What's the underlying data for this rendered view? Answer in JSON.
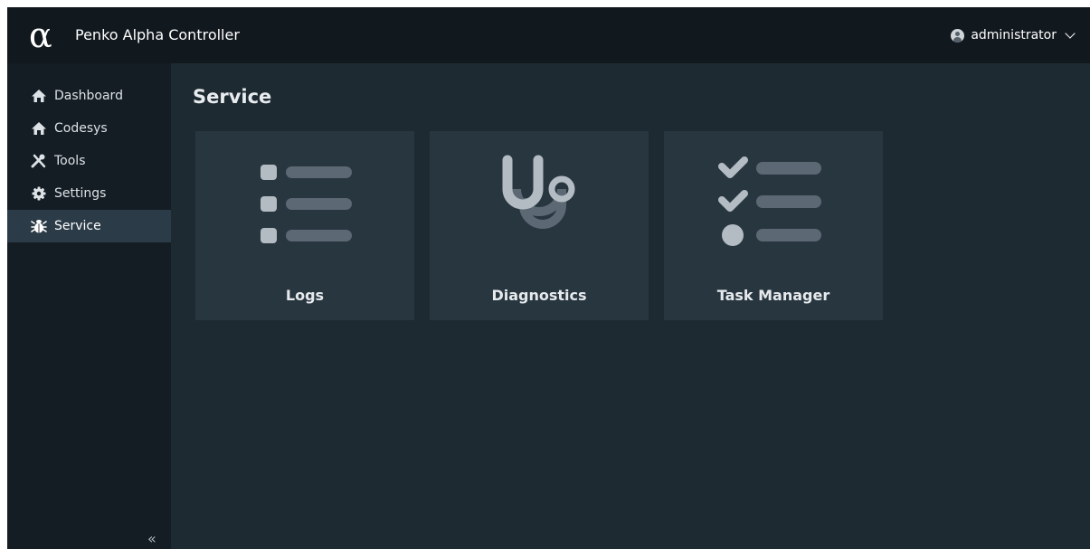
{
  "header": {
    "logo_glyph": "α",
    "app_title": "Penko Alpha Controller",
    "user": {
      "name": "administrator",
      "icon": "user-circle-icon"
    }
  },
  "sidebar": {
    "items": [
      {
        "label": "Dashboard",
        "icon": "home-icon",
        "active": false
      },
      {
        "label": "Codesys",
        "icon": "home-icon",
        "active": false
      },
      {
        "label": "Tools",
        "icon": "tools-icon",
        "active": false
      },
      {
        "label": "Settings",
        "icon": "gear-icon",
        "active": false
      },
      {
        "label": "Service",
        "icon": "bug-icon",
        "active": true
      }
    ],
    "collapse_glyph": "«"
  },
  "main": {
    "title": "Service",
    "cards": [
      {
        "label": "Logs",
        "icon": "list-icon"
      },
      {
        "label": "Diagnostics",
        "icon": "stethoscope-icon"
      },
      {
        "label": "Task Manager",
        "icon": "checklist-icon"
      }
    ]
  },
  "colors": {
    "topbar": "#11181e",
    "sidebar": "#141d24",
    "content": "#1e2a32",
    "card": "#283640",
    "active_item": "#2b3b47",
    "icon_light": "#b4bcc3",
    "icon_dark": "#5c6873"
  }
}
